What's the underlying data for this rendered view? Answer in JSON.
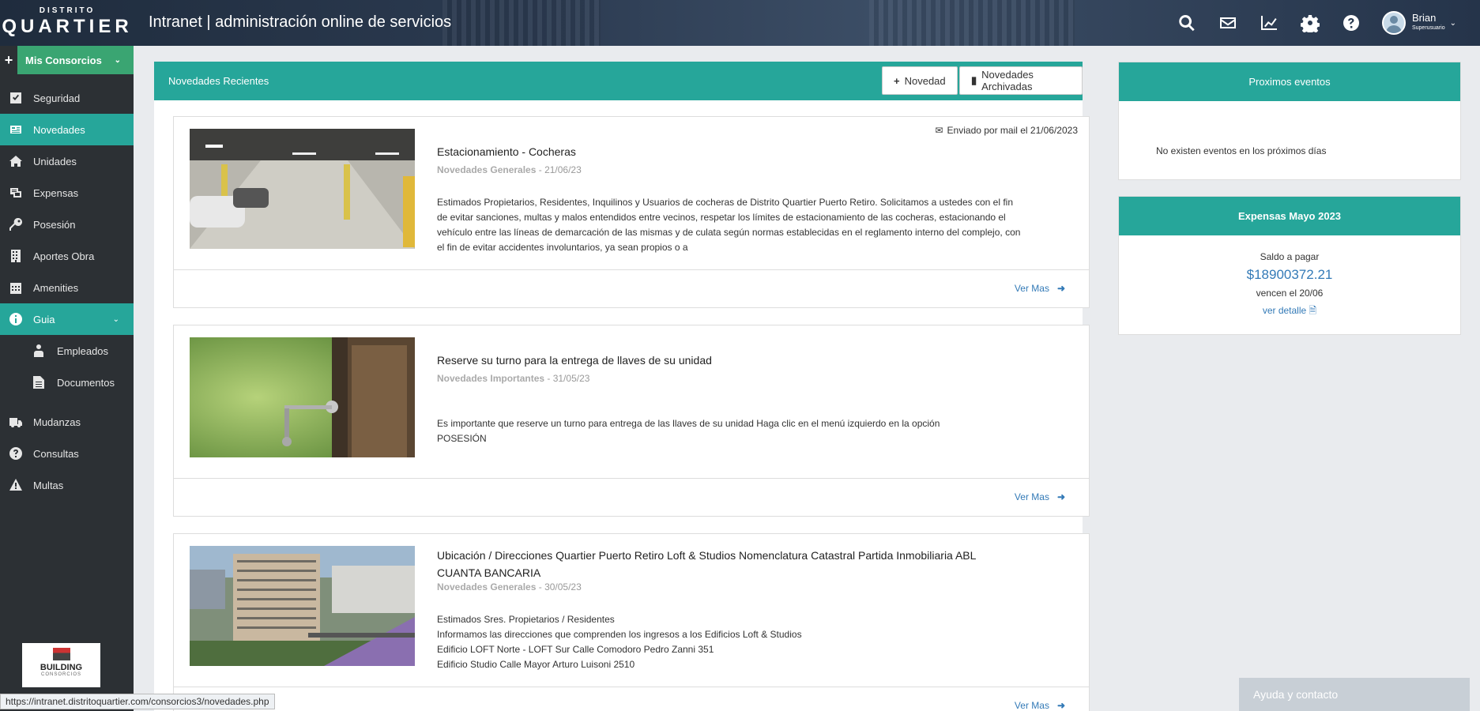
{
  "header": {
    "logo_small": "DISTRITO",
    "logo_big": "QUARTIER",
    "title": "Intranet | administración online de servicios",
    "icons": [
      "search-icon",
      "mail-icon",
      "chart-icon",
      "gear-icon",
      "help-icon"
    ],
    "user_name": "Brian",
    "user_role": "Superusuario"
  },
  "sidebar": {
    "mis_consorcios": "Mis Consorcios",
    "items": [
      {
        "label": "Seguridad",
        "icon": "check-square-icon"
      },
      {
        "label": "Novedades",
        "icon": "news-icon",
        "active": true
      },
      {
        "label": "Unidades",
        "icon": "home-icon"
      },
      {
        "label": "Expensas",
        "icon": "receipt-icon"
      },
      {
        "label": "Posesión",
        "icon": "key-icon"
      },
      {
        "label": "Aportes Obra",
        "icon": "building-icon"
      },
      {
        "label": "Amenities",
        "icon": "calendar-icon"
      },
      {
        "label": "Guia",
        "icon": "info-icon",
        "active": true
      },
      {
        "label": "Empleados",
        "icon": "employee-icon"
      },
      {
        "label": "Documentos",
        "icon": "document-icon"
      },
      {
        "label": "Mudanzas",
        "icon": "truck-icon"
      },
      {
        "label": "Consultas",
        "icon": "question-icon"
      },
      {
        "label": "Multas",
        "icon": "warning-icon"
      }
    ],
    "footer_logo": {
      "name": "BUILDING",
      "sub": "CONSORCIOS"
    }
  },
  "main": {
    "title": "Novedades Recientes",
    "btn_novedad": "Novedad",
    "btn_archivadas": "Novedades Archivadas",
    "ver_mas": "Ver Mas",
    "news": [
      {
        "mail": "Enviado por mail el 21/06/2023",
        "title": "Estacionamiento - Cocheras",
        "category": "Novedades Generales",
        "date": " - 21/06/23",
        "body": "Estimados Propietarios, Residentes, Inquilinos y Usuarios de cocheras de Distrito Quartier Puerto Retiro. Solicitamos a ustedes con el fin de evitar sanciones, multas y malos entendidos entre vecinos, respetar los límites de estacionamiento de las cocheras, estacionando el vehículo entre las líneas de demarcación de las mismas y de culata según normas establecidas en el reglamento interno del complejo, con el fin de evitar accidentes involuntarios, ya sean propios o a"
      },
      {
        "title": "Reserve su turno para la entrega de llaves de su unidad",
        "category": "Novedades Importantes",
        "date": " - 31/05/23",
        "body": "Es importante que reserve un turno para entrega de las llaves de su unidad Haga clic en el menú izquierdo en la opción POSESIÓN"
      },
      {
        "title": "Ubicación / Direcciones Quartier Puerto Retiro Loft & Studios Nomenclatura Catastral Partida Inmobiliaria ABL CUANTA BANCARIA",
        "category": "Novedades Generales",
        "date": " - 30/05/23",
        "body_lines": [
          "Estimados Sres. Propietarios / Residentes",
          "Informamos las direcciones que comprenden los ingresos a los Edificios Loft & Studios",
          "Edificio LOFT Norte - LOFT Sur Calle Comodoro Pedro Zanni 351",
          "Edificio Studio Calle Mayor Arturo Luisoni 2510"
        ]
      }
    ]
  },
  "events": {
    "title": "Proximos eventos",
    "empty_text": "No existen eventos en los próximos días"
  },
  "expensas": {
    "title": "Expensas Mayo 2023",
    "saldo_label": "Saldo a pagar",
    "amount": "$18900372.21",
    "vencen": "vencen el 20/06",
    "detalle": "ver detalle"
  },
  "ayuda": "Ayuda y contacto",
  "status_url": "https://intranet.distritoquartier.com/consorcios3/novedades.php",
  "colors": {
    "teal": "#26a69a",
    "green": "#3aa572",
    "link": "#337ab7",
    "sidebar": "#2c3034"
  }
}
